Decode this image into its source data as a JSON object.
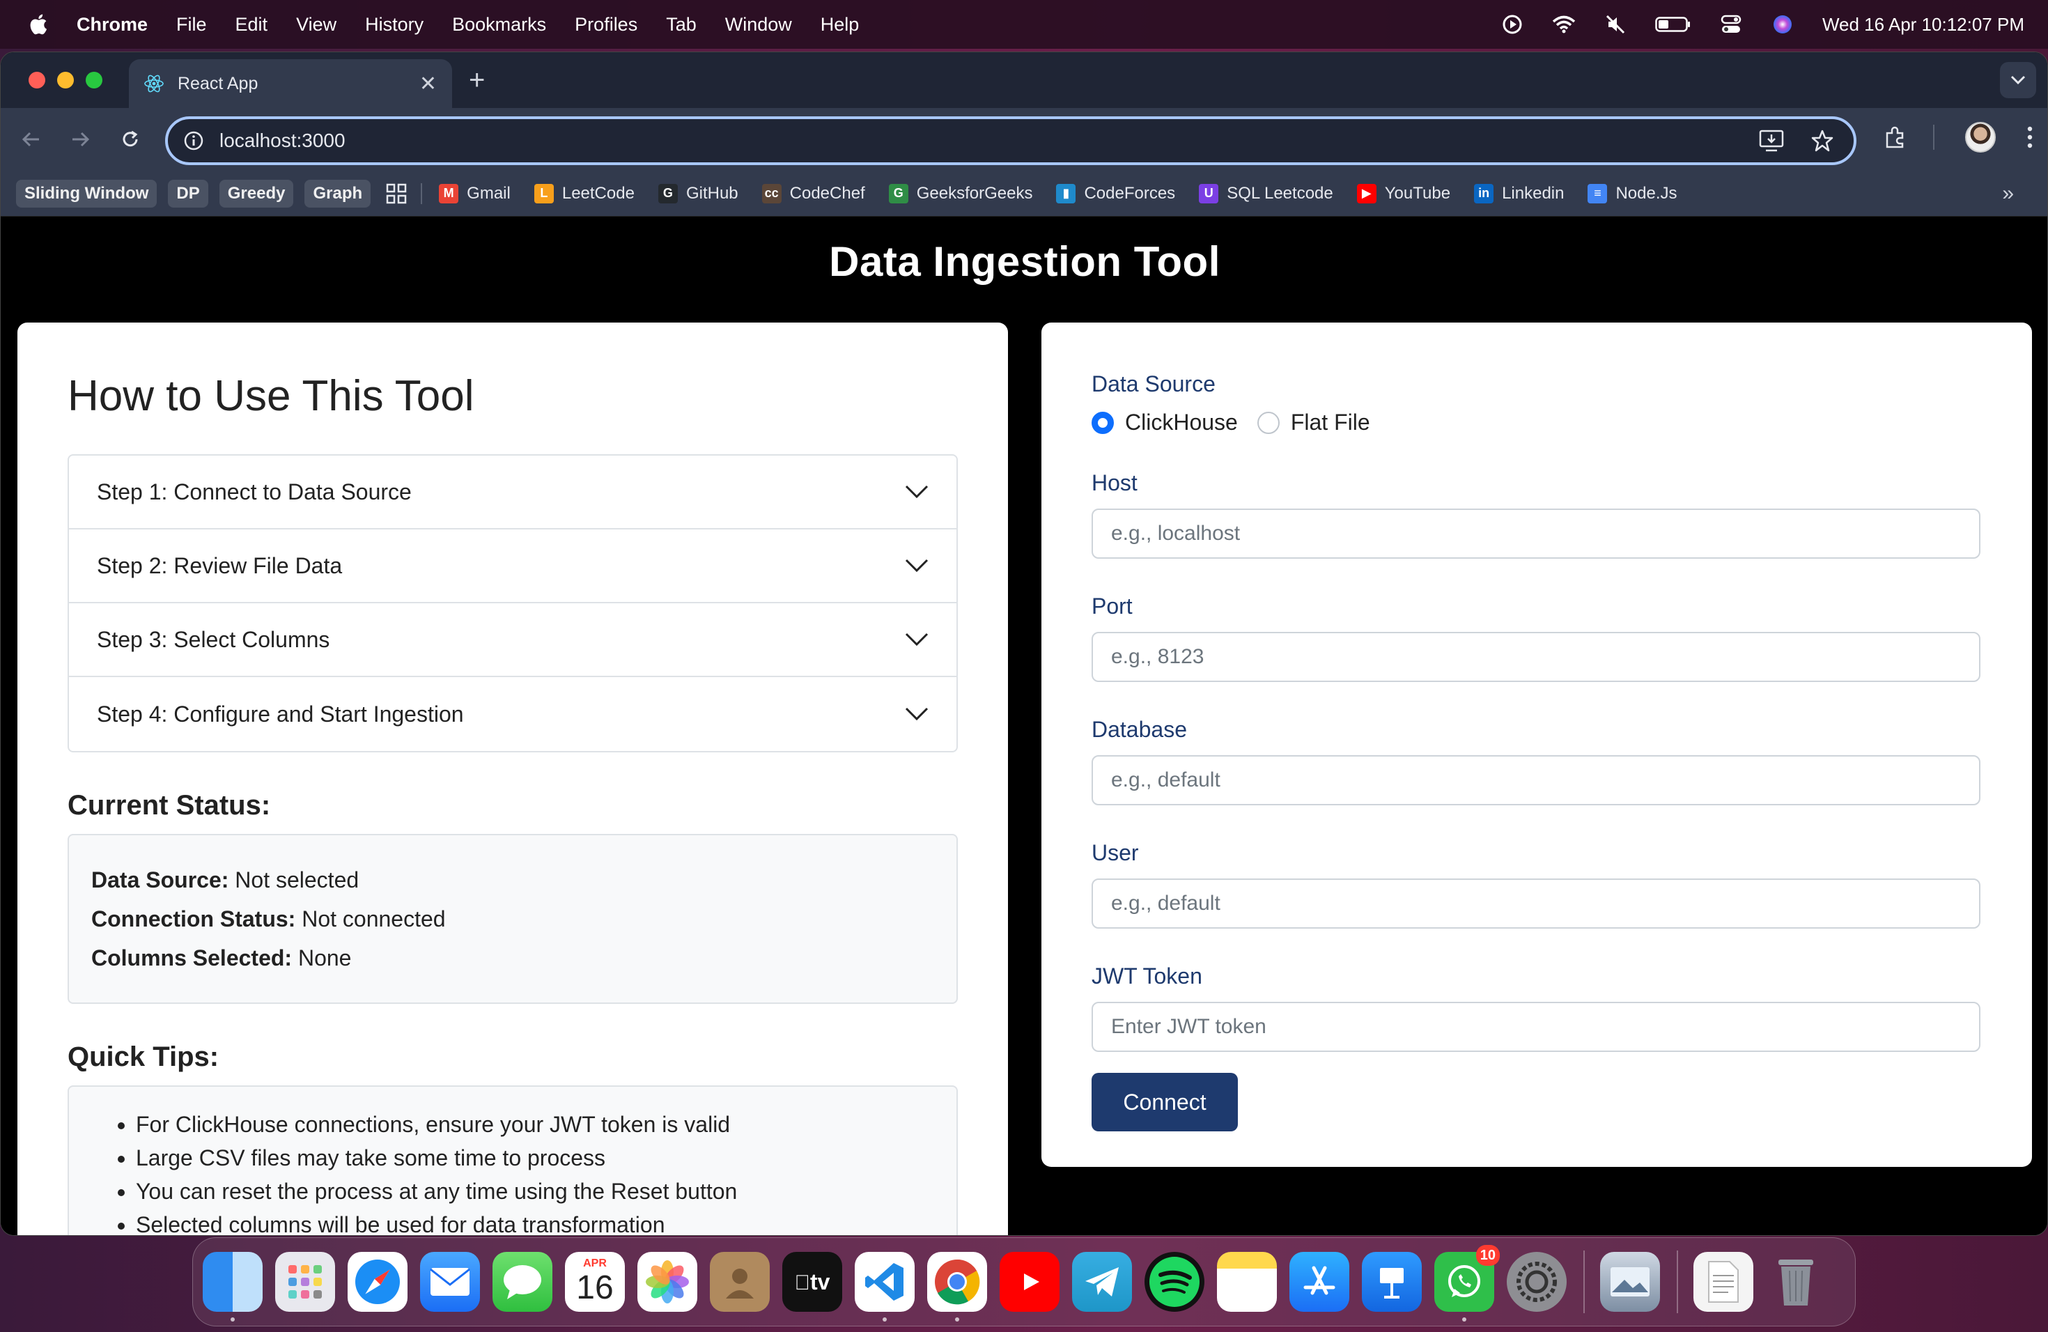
{
  "menubar": {
    "app_name": "Chrome",
    "items": [
      "File",
      "Edit",
      "View",
      "History",
      "Bookmarks",
      "Profiles",
      "Tab",
      "Window",
      "Help"
    ],
    "clock": "Wed 16 Apr  10:12:07 PM",
    "status_icons": [
      "play-circle-icon",
      "wifi-icon",
      "mute-icon",
      "battery-icon",
      "control-center-icon",
      "siri-icon"
    ]
  },
  "browser": {
    "tab_title": "React App",
    "url": "localhost:3000",
    "bookmark_folders": [
      "Sliding Window",
      "DP",
      "Greedy",
      "Graph"
    ],
    "bookmarks": [
      {
        "label": "Gmail",
        "icon": "gmail-icon",
        "color": "#ea4335",
        "glyph": "M"
      },
      {
        "label": "LeetCode",
        "icon": "leetcode-icon",
        "color": "#f89f1b",
        "glyph": "L"
      },
      {
        "label": "GitHub",
        "icon": "github-icon",
        "color": "#24292e",
        "glyph": "G"
      },
      {
        "label": "CodeChef",
        "icon": "codechef-icon",
        "color": "#5b4638",
        "glyph": "cc"
      },
      {
        "label": "GeeksforGeeks",
        "icon": "geeksforgeeks-icon",
        "color": "#2f8d46",
        "glyph": "G"
      },
      {
        "label": "CodeForces",
        "icon": "codeforces-icon",
        "color": "#1f8acb",
        "glyph": "▮"
      },
      {
        "label": "SQL Leetcode",
        "icon": "sql-leetcode-icon",
        "color": "#7b3fe4",
        "glyph": "U"
      },
      {
        "label": "YouTube",
        "icon": "youtube-icon",
        "color": "#ff0000",
        "glyph": "▶"
      },
      {
        "label": "Linkedin",
        "icon": "linkedin-icon",
        "color": "#0a66c2",
        "glyph": "in"
      },
      {
        "label": "Node.Js",
        "icon": "docs-icon",
        "color": "#4285f4",
        "glyph": "≡"
      }
    ]
  },
  "page": {
    "title": "Data Ingestion Tool",
    "howto": {
      "title": "How to Use This Tool",
      "steps": [
        "Step 1: Connect to Data Source",
        "Step 2: Review File Data",
        "Step 3: Select Columns",
        "Step 4: Configure and Start Ingestion"
      ]
    },
    "status": {
      "heading": "Current Status:",
      "data_source_label": "Data Source:",
      "data_source_value": "Not selected",
      "connection_label": "Connection Status:",
      "connection_value": "Not connected",
      "columns_label": "Columns Selected:",
      "columns_value": "None"
    },
    "tips": {
      "heading": "Quick Tips:",
      "items": [
        "For ClickHouse connections, ensure your JWT token is valid",
        "Large CSV files may take some time to process",
        "You can reset the process at any time using the Reset button",
        "Selected columns will be used for data transformation"
      ]
    },
    "form": {
      "data_source_label": "Data Source",
      "options": [
        "ClickHouse",
        "Flat File"
      ],
      "selected_option": "ClickHouse",
      "fields": [
        {
          "label": "Host",
          "placeholder": "e.g., localhost",
          "value": ""
        },
        {
          "label": "Port",
          "placeholder": "e.g., 8123",
          "value": ""
        },
        {
          "label": "Database",
          "placeholder": "e.g., default",
          "value": ""
        },
        {
          "label": "User",
          "placeholder": "e.g., default",
          "value": ""
        },
        {
          "label": "JWT Token",
          "placeholder": "Enter JWT token",
          "value": ""
        }
      ],
      "connect_label": "Connect"
    }
  },
  "dock": {
    "calendar_month": "APR",
    "calendar_day": "16",
    "whatsapp_badge": "10",
    "apple_tv_label": "tv"
  },
  "colors": {
    "accent": "#1e3a6e",
    "radio_checked": "#0d6efd",
    "label": "#1e3a6e",
    "omnibox_focus": "#a8c7fa"
  }
}
